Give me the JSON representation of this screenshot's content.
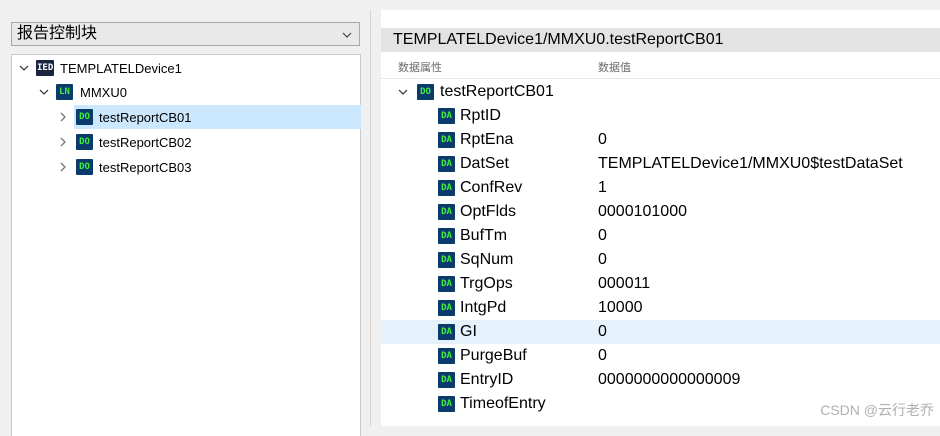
{
  "left": {
    "combo_label": "报告控制块",
    "tree": [
      {
        "badge": "IED",
        "label": "TEMPLATELDevice1",
        "expanded": true
      },
      {
        "badge": "LN",
        "label": "MMXU0",
        "expanded": true
      },
      {
        "badge": "DO",
        "label": "testReportCB01",
        "expanded": false,
        "selected": true
      },
      {
        "badge": "DO",
        "label": "testReportCB02",
        "expanded": false
      },
      {
        "badge": "DO",
        "label": "testReportCB03",
        "expanded": false
      }
    ]
  },
  "right": {
    "title": "TEMPLATELDevice1/MMXU0.testReportCB01",
    "col_attr": "数据属性",
    "col_value": "数据值",
    "root": {
      "badge": "DO",
      "label": "testReportCB01"
    },
    "rows": [
      {
        "badge": "DA",
        "name": "RptID",
        "value": ""
      },
      {
        "badge": "DA",
        "name": "RptEna",
        "value": "0"
      },
      {
        "badge": "DA",
        "name": "DatSet",
        "value": "TEMPLATELDevice1/MMXU0$testDataSet"
      },
      {
        "badge": "DA",
        "name": "ConfRev",
        "value": "1"
      },
      {
        "badge": "DA",
        "name": "OptFlds",
        "value": "0000101000"
      },
      {
        "badge": "DA",
        "name": "BufTm",
        "value": "0"
      },
      {
        "badge": "DA",
        "name": "SqNum",
        "value": "0"
      },
      {
        "badge": "DA",
        "name": "TrgOps",
        "value": "000011"
      },
      {
        "badge": "DA",
        "name": "IntgPd",
        "value": "10000"
      },
      {
        "badge": "DA",
        "name": "GI",
        "value": "0",
        "selected": true
      },
      {
        "badge": "DA",
        "name": "PurgeBuf",
        "value": "0"
      },
      {
        "badge": "DA",
        "name": "EntryID",
        "value": "0000000000000009"
      },
      {
        "badge": "DA",
        "name": "TimeofEntry",
        "value": ""
      }
    ]
  },
  "watermark": "CSDN @云行老乔"
}
